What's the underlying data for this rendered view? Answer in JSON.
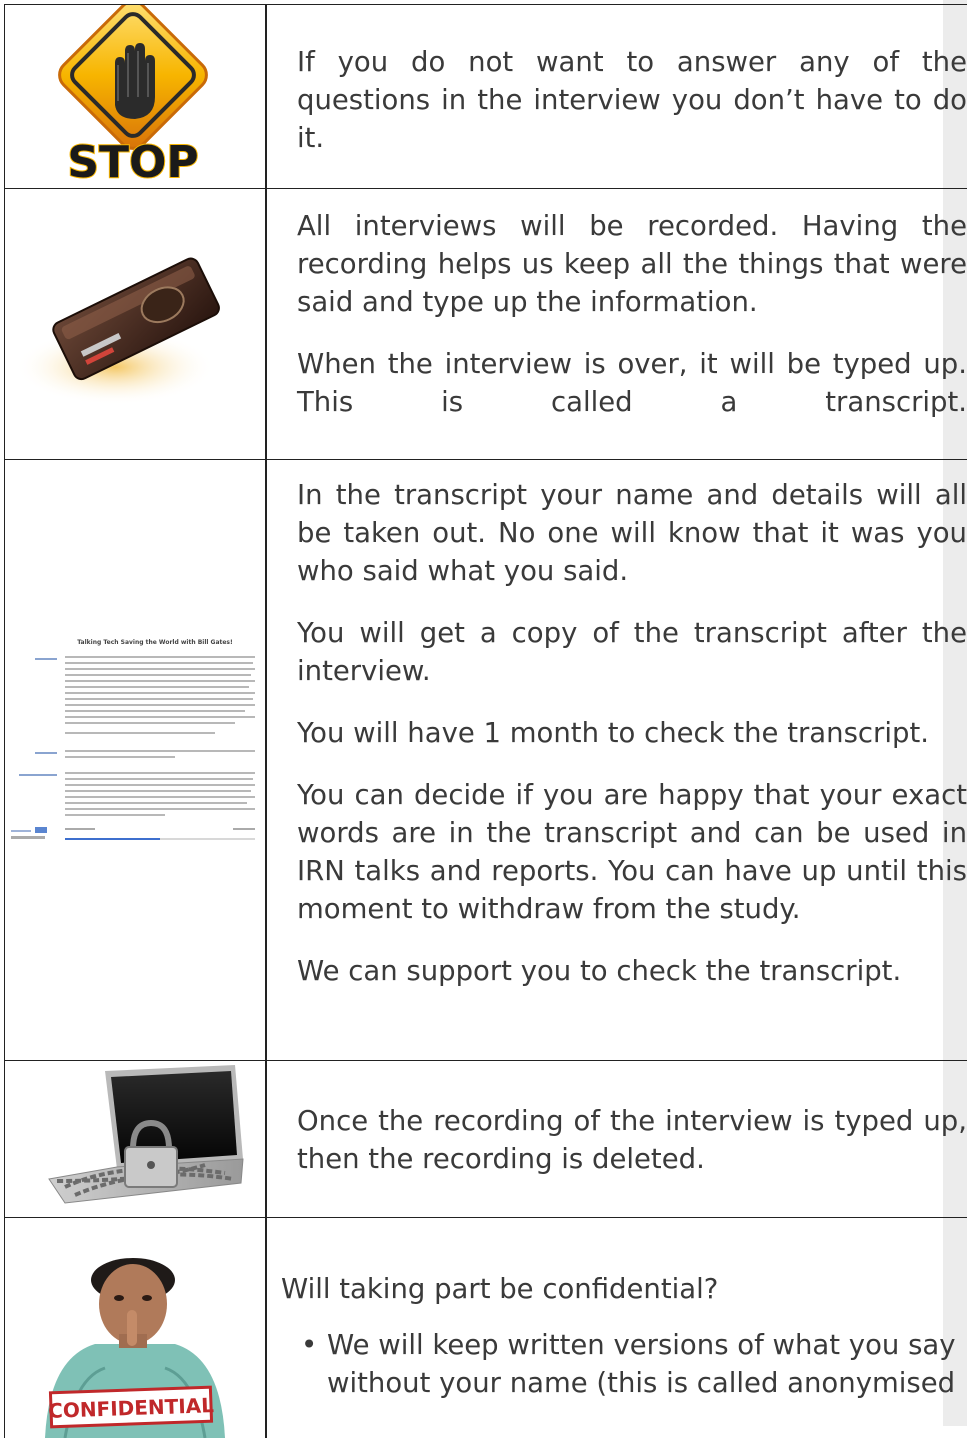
{
  "rows": [
    {
      "paragraphs": [
        "If you do not want to answer any of the questions in the interview you don’t have to do it."
      ]
    },
    {
      "paragraphs": [
        "All interviews will be recorded. Having the recording helps us keep all the things that were said and type up the information.",
        "When the interview is over, it will be typed up. This is called a transcript."
      ]
    },
    {
      "paragraphs": [
        "In the transcript your name and details will all be taken out. No one will know that it was you who said what you said.",
        "You will get a copy of the transcript after the interview.",
        "You will have 1 month to check the transcript.",
        "You can decide if you are happy that your exact words are in the transcript and can be used in IRN talks and reports. You can have up until this moment to withdraw from the study.",
        "We can support you to check the transcript."
      ],
      "thumbnail_title": "Talking Tech Saving the World with Bill Gates!"
    },
    {
      "paragraphs": [
        "Once the recording of the interview is typed up, then the recording is deleted."
      ]
    },
    {
      "question": "Will taking part be confidential?",
      "bullets": [
        "We will keep written versions of what you say without your name (this is called anonymised"
      ],
      "sign_text": "CONFIDENTIAL"
    }
  ],
  "stop_sign_text": "STOP",
  "colors": {
    "stop_yellow": "#f4b400",
    "stop_orange": "#e07a10",
    "text": "#3a3a3a",
    "border": "#222222",
    "side_band": "#ececec",
    "confidential_red": "#c0282a"
  }
}
